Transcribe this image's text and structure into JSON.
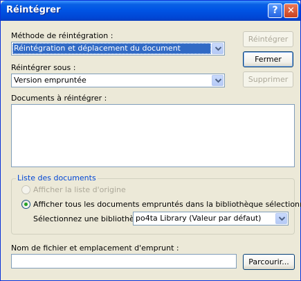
{
  "window": {
    "title": "Réintégrer",
    "help_glyph": "?",
    "close_glyph": "✕"
  },
  "method": {
    "label": "Méthode de réintégration :",
    "value": "Réintégration et déplacement du document"
  },
  "reintegrate_as": {
    "label": "Réintégrer sous :",
    "value": "Version empruntée"
  },
  "documents": {
    "label": "Documents à réintégrer :"
  },
  "doc_list": {
    "legend": "Liste des documents",
    "option_origin": "Afficher la liste d'origine",
    "option_all": "Afficher tous les documents empruntés dans la bibliothèque sélectionnée",
    "library_label": "Sélectionnez une bibliothèque :",
    "library_value": "po4ta Library  (Valeur par défaut)",
    "selected_option": "option_all"
  },
  "filename": {
    "label": "Nom de fichier et emplacement d'emprunt :",
    "value": ""
  },
  "buttons": {
    "reintegrate": "Réintégrer",
    "close": "Fermer",
    "delete": "Supprimer",
    "browse": "Parcourir..."
  },
  "colors": {
    "title_bar": "#0055e5",
    "dialog_bg": "#ece9d8",
    "selection": "#316ac5",
    "group_legend": "#0046d5"
  }
}
